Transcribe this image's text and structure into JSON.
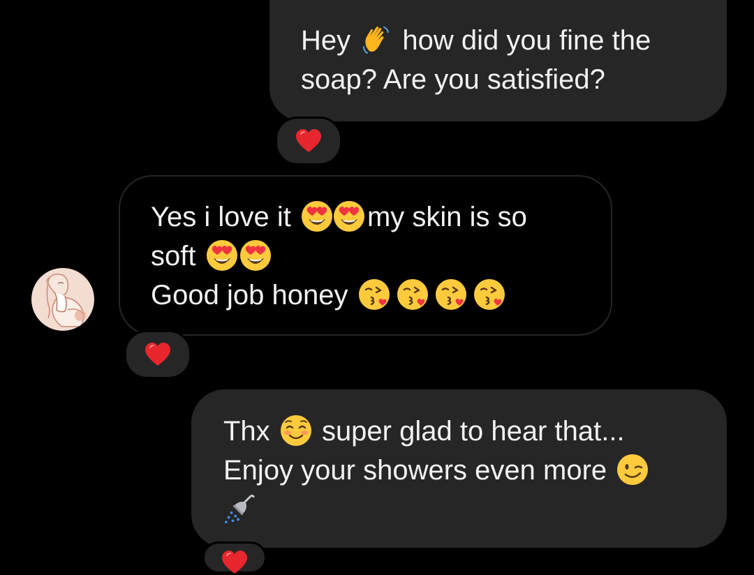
{
  "conversation": {
    "messages": [
      {
        "direction": "outgoing",
        "line1_a": "Hey",
        "line1_emoji": "waving-hand-emoji",
        "line1_b": "how did you fine the",
        "line2": "soap? Are you satisfied?",
        "reaction": "red-heart-emoji"
      },
      {
        "direction": "incoming",
        "line1_a": "Yes i love it",
        "line1_emojis": [
          "heart-eyes-emoji",
          "heart-eyes-emoji"
        ],
        "line1_b": "my skin is so",
        "line2": "soft",
        "line2_emojis": [
          "heart-eyes-emoji",
          "heart-eyes-emoji"
        ],
        "line3": "Good job honey",
        "line3_emojis": [
          "kissing-heart-emoji",
          "kissing-heart-emoji",
          "kissing-heart-emoji",
          "kissing-heart-emoji"
        ],
        "reaction": "red-heart-emoji"
      },
      {
        "direction": "outgoing",
        "line1_a": "Thx",
        "line1_emoji": "smiling-blush-emoji",
        "line1_b": "super glad to hear that...",
        "line2": "Enjoy your showers even more",
        "line2_emoji": "winking-face-emoji",
        "line3_emoji": "shower-emoji",
        "reaction": "red-heart-emoji"
      }
    ]
  },
  "colors": {
    "background": "#000000",
    "outgoing_bubble": "#262626",
    "incoming_border": "#262626",
    "text": "#f2f2f2",
    "heart": "#e8262d"
  }
}
